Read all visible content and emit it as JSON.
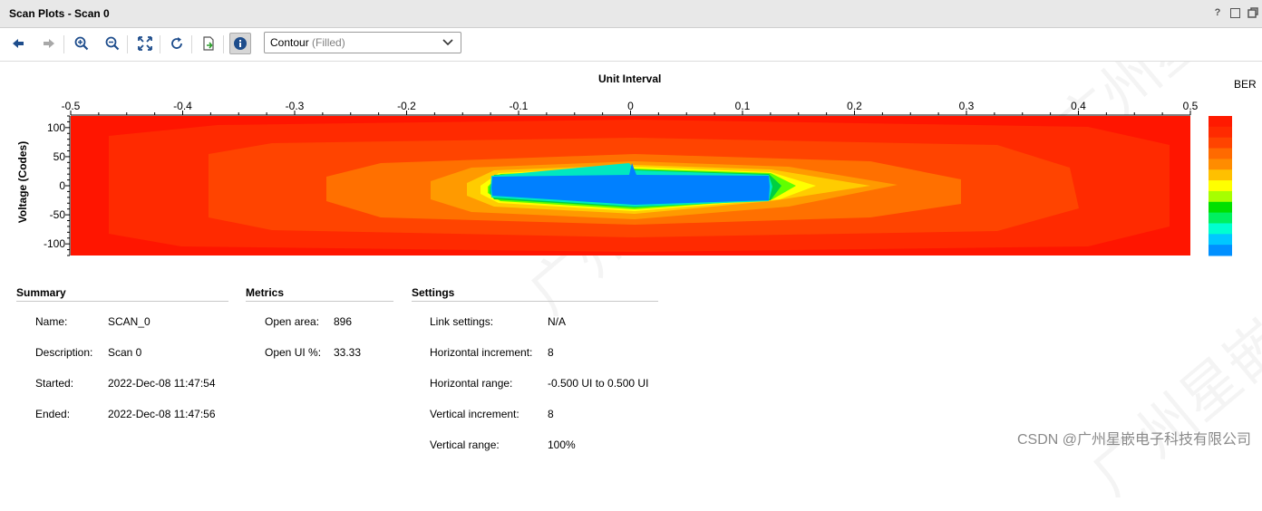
{
  "window": {
    "title": "Scan Plots - Scan 0",
    "help_label": "?"
  },
  "toolbar": {
    "icons": [
      "back-arrow-icon",
      "forward-arrow-icon",
      "zoom-in-icon",
      "zoom-out-icon",
      "fit-to-view-icon",
      "refresh-icon",
      "export-icon",
      "info-icon"
    ],
    "plot_type": "Contour",
    "plot_type_sub": "(Filled)"
  },
  "chart_data": {
    "type": "heatmap",
    "xlabel": "Unit Interval",
    "ylabel": "Voltage (Codes)",
    "xlim": [
      -0.5,
      0.5
    ],
    "ylim": [
      -120,
      120
    ],
    "x_ticks": [
      "-0.5",
      "-0.4",
      "-0.3",
      "-0.2",
      "-0.1",
      "0",
      "0.1",
      "0.2",
      "0.3",
      "0.4",
      "0.5"
    ],
    "y_ticks": [
      "100",
      "50",
      "0",
      "-50",
      "-100"
    ],
    "legend_title": "BER",
    "legend_colors": [
      "#ff1a00",
      "#ff2a00",
      "#ff4400",
      "#ff6a00",
      "#ff8c00",
      "#ffc000",
      "#ffff00",
      "#a6ff00",
      "#00e000",
      "#00f060",
      "#00ffd0",
      "#00c8ff",
      "#0090ff"
    ],
    "eye_center_color": "#0080ff"
  },
  "summary": {
    "heading": "Summary",
    "rows": [
      {
        "label": "Name:",
        "value": "SCAN_0"
      },
      {
        "label": "Description:",
        "value": "Scan 0"
      },
      {
        "label": "Started:",
        "value": "2022-Dec-08 11:47:54"
      },
      {
        "label": "Ended:",
        "value": "2022-Dec-08 11:47:56"
      }
    ]
  },
  "metrics": {
    "heading": "Metrics",
    "rows": [
      {
        "label": "Open area:",
        "value": "896"
      },
      {
        "label": "Open UI %:",
        "value": "33.33"
      }
    ]
  },
  "settings": {
    "heading": "Settings",
    "rows": [
      {
        "label": "Link settings:",
        "value": "N/A"
      },
      {
        "label": "Horizontal increment:",
        "value": "8"
      },
      {
        "label": "Horizontal range:",
        "value": "-0.500 UI to 0.500 UI"
      },
      {
        "label": "Vertical increment:",
        "value": "8"
      },
      {
        "label": "Vertical range:",
        "value": "100%"
      }
    ]
  },
  "watermark": "CSDN @广州星嵌电子科技有限公司",
  "watermark_faint": "广州星嵌"
}
